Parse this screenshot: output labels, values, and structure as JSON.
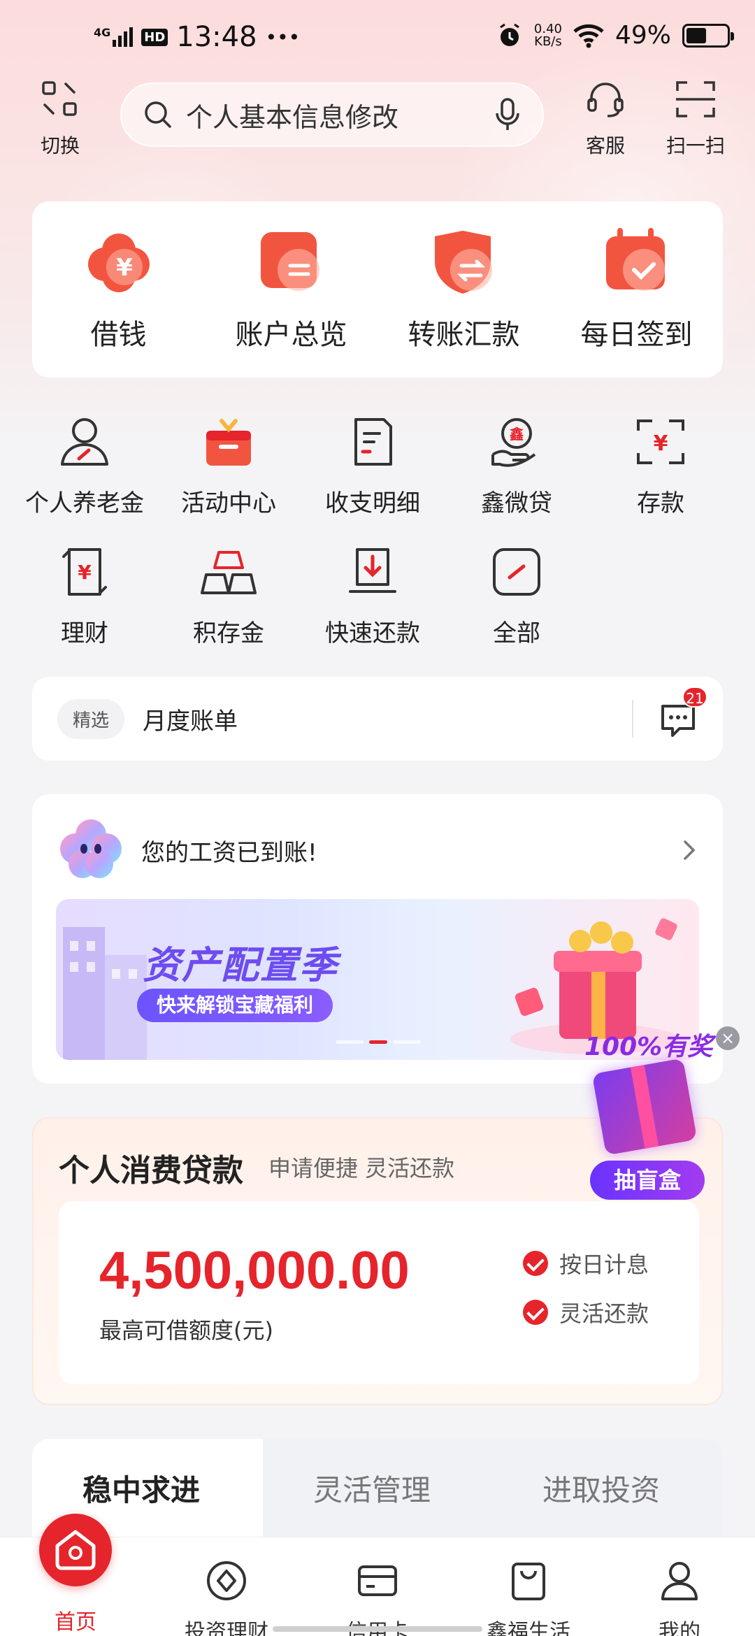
{
  "status_bar": {
    "network": "4G",
    "hd": "HD",
    "time": "13:48",
    "more": "•••",
    "speed_value": "0.40",
    "speed_unit": "KB/s",
    "battery": "49%"
  },
  "header": {
    "switch_label": "切换",
    "search_placeholder": "个人基本信息修改",
    "service_label": "客服",
    "scan_label": "扫一扫"
  },
  "quick_actions": [
    {
      "label": "借钱",
      "icon": "yuan-flower-icon"
    },
    {
      "label": "账户总览",
      "icon": "account-overview-icon"
    },
    {
      "label": "转账汇款",
      "icon": "transfer-icon"
    },
    {
      "label": "每日签到",
      "icon": "checkin-calendar-icon"
    }
  ],
  "grid": [
    {
      "label": "个人养老金",
      "icon": "person-pension-icon"
    },
    {
      "label": "活动中心",
      "icon": "gift-box-icon"
    },
    {
      "label": "收支明细",
      "icon": "statement-icon"
    },
    {
      "label": "鑫微贷",
      "icon": "loan-hand-icon"
    },
    {
      "label": "存款",
      "icon": "deposit-icon"
    },
    {
      "label": "理财",
      "icon": "wealth-icon"
    },
    {
      "label": "积存金",
      "icon": "gold-bars-icon"
    },
    {
      "label": "快速还款",
      "icon": "repay-icon"
    },
    {
      "label": "全部",
      "icon": "all-icon"
    }
  ],
  "notice": {
    "tag": "精选",
    "text": "月度账单",
    "badge": "21"
  },
  "salary": {
    "text": "您的工资已到账!",
    "banner_title": "资产配置季",
    "banner_pill": "快来解锁宝藏福利"
  },
  "floating_gift": {
    "title": "100%有奖",
    "button": "抽盲盒",
    "close": "×"
  },
  "loan": {
    "title": "个人消费贷款",
    "subtitle": "申请便捷 灵活还款",
    "amount": "4,500,000.00",
    "amount_label": "最高可借额度(元)",
    "features": [
      "按日计息",
      "灵活还款"
    ]
  },
  "invest_tabs": [
    "稳中求进",
    "灵活管理",
    "进取投资"
  ],
  "bottom_nav": [
    {
      "label": "首页"
    },
    {
      "label": "投资理财"
    },
    {
      "label": "信用卡"
    },
    {
      "label": "鑫福生活"
    },
    {
      "label": "我的"
    }
  ],
  "colors": {
    "accent": "#e5242b",
    "icon_orange": "#f2553f"
  }
}
